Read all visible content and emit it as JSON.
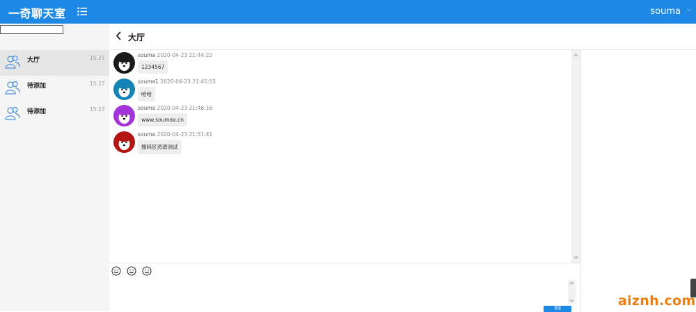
{
  "header": {
    "brand": "一奇聊天室",
    "username": "souma",
    "menu_icon": "list-icon",
    "user_menu_icon": "chevron-down-icon",
    "color": "#1e88e5"
  },
  "sidebar": {
    "search_value": "",
    "conversations": [
      {
        "name": "大厅",
        "time": "15:27",
        "icon": "group-icon",
        "active": true
      },
      {
        "name": "待添加",
        "time": "15:27",
        "icon": "group-icon",
        "active": false
      },
      {
        "name": "待添加",
        "time": "15:27",
        "icon": "group-icon",
        "active": false
      }
    ]
  },
  "chat": {
    "title": "大厅",
    "back_icon": "chevron-left-icon",
    "messages": [
      {
        "user": "souma",
        "time": "2020-04-23 21:44:22",
        "text": "1234567",
        "avatar_color": "#1a1a1a"
      },
      {
        "user": "souma1",
        "time": "2020-04-23 21:45:55",
        "text": "哈哈",
        "avatar_color": "#1483b5"
      },
      {
        "user": "souma",
        "time": "2020-04-23 21:46:16",
        "text": "www.soumax.cn",
        "avatar_color": "#a234d8"
      },
      {
        "user": "souma",
        "time": "2020-04-23 21:51:41",
        "text": "搜码区资源测试",
        "avatar_color": "#b51414"
      }
    ]
  },
  "composer": {
    "emoji_icons": [
      "smiley-icon",
      "smiley-icon",
      "smiley-icon"
    ],
    "input_value": "",
    "send_label": "发送"
  },
  "watermark": "aiznh.com"
}
